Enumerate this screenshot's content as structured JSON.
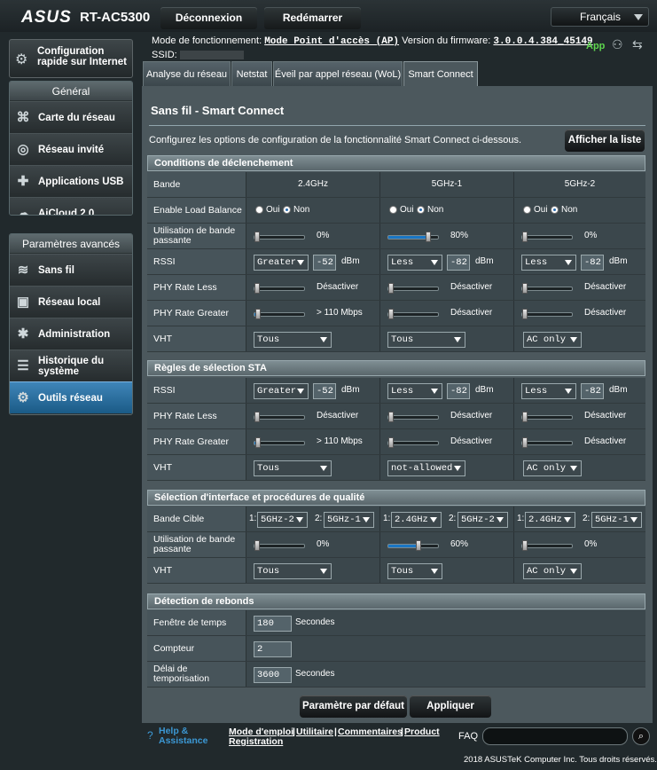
{
  "header": {
    "logo": "ASUS",
    "model": "RT-AC5300",
    "logout": "Déconnexion",
    "reboot": "Redémarrer",
    "language": "Français"
  },
  "sidebar": {
    "quick_setup": "Configuration rapide sur Internet",
    "general_title": "Général",
    "general_items": [
      "Carte du réseau",
      "Réseau invité",
      "Applications USB",
      "AiCloud 2.0"
    ],
    "advanced_title": "Paramètres avancés",
    "advanced_items": [
      "Sans fil",
      "Réseau local",
      "Administration",
      "Historique du système",
      "Outils réseau"
    ]
  },
  "info": {
    "mode_label": "Mode de fonctionnement:",
    "mode_value": "Mode Point d'accès (AP)",
    "fw_label": "Version du firmware:",
    "fw_value": "3.0.0.4.384_45149",
    "ssid_label": "SSID:",
    "app": "App"
  },
  "tabs": [
    "Analyse du réseau",
    "Netstat",
    "Éveil par appel réseau (WoL)",
    "Smart Connect"
  ],
  "page": {
    "title": "Sans fil - Smart Connect",
    "description": "Configurez les options de configuration de la fonctionnalité Smart Connect ci-dessous.",
    "show_list": "Afficher la liste"
  },
  "trigger": {
    "title": "Conditions de déclenchement",
    "band_label": "Bande",
    "bands": [
      "2.4GHz",
      "5GHz-1",
      "5GHz-2"
    ],
    "load_balance_label": "Enable Load Balance",
    "yes": "Oui",
    "no": "Non",
    "bw_label": "Utilisation de bande passante",
    "bw_values": [
      "0%",
      "80%",
      "0%"
    ],
    "rssi_label": "RSSI",
    "rssi_ops": [
      "Greater",
      "Less",
      "Less"
    ],
    "rssi_values": [
      "-52",
      "-82",
      "-82"
    ],
    "dbm": "dBm",
    "phy_less_label": "PHY Rate Less",
    "phy_less": [
      "Désactiver",
      "Désactiver",
      "Désactiver"
    ],
    "phy_greater_label": "PHY Rate Greater",
    "phy_greater": [
      "> 110 Mbps",
      "Désactiver",
      "Désactiver"
    ],
    "vht_label": "VHT",
    "vht": [
      "Tous",
      "Tous",
      "AC only"
    ]
  },
  "sta": {
    "title": "Règles de sélection STA",
    "rssi_label": "RSSI",
    "rssi_ops": [
      "Greater",
      "Less",
      "Less"
    ],
    "rssi_values": [
      "-52",
      "-82",
      "-82"
    ],
    "dbm": "dBm",
    "phy_less_label": "PHY Rate Less",
    "phy_less": [
      "Désactiver",
      "Désactiver",
      "Désactiver"
    ],
    "phy_greater_label": "PHY Rate Greater",
    "phy_greater": [
      "> 110 Mbps",
      "Désactiver",
      "Désactiver"
    ],
    "vht_label": "VHT",
    "vht": [
      "Tous",
      "not-allowed",
      "AC only"
    ]
  },
  "iface": {
    "title": "Sélection d'interface et procédures de qualité",
    "target_label": "Bande Cible",
    "n1": "1:",
    "n2": "2:",
    "targets": [
      [
        "5GHz-2",
        "5GHz-1"
      ],
      [
        "2.4GHz",
        "5GHz-2"
      ],
      [
        "2.4GHz",
        "5GHz-1"
      ]
    ],
    "bw_label": "Utilisation de bande passante",
    "bw_values": [
      "0%",
      "60%",
      "0%"
    ],
    "vht_label": "VHT",
    "vht": [
      "Tous",
      "Tous",
      "AC only"
    ]
  },
  "bounce": {
    "title": "Détection de rebonds",
    "window_label": "Fenêtre de temps",
    "window_value": "180",
    "seconds": "Secondes",
    "counter_label": "Compteur",
    "counter_value": "2",
    "timeout_label": "Délai de temporisation",
    "timeout_value": "3600",
    "seconds2": "Secondes"
  },
  "actions": {
    "default": "Paramètre par défaut",
    "apply": "Appliquer"
  },
  "footer": {
    "help1": "Help &",
    "help2": "Assistance",
    "manual": "Mode d'emploi",
    "utility": "Utilitaire",
    "feedback": "Commentaires",
    "product": "Product",
    "registration": "Registration",
    "sep": "|",
    "faq": "FAQ",
    "copyright": "2018 ASUSTeK Computer Inc. Tous droits réservés."
  },
  "levels": {
    "trigger_bw": [
      0,
      0.8,
      0
    ],
    "trigger_phy_greater": [
      0.08,
      0,
      0
    ],
    "sta_phy_greater": [
      0.08,
      0,
      0
    ],
    "iface_bw": [
      0,
      0.6,
      0
    ]
  },
  "colors": {
    "accent": "#1a76c4",
    "active_menu": "#2f77ab"
  }
}
